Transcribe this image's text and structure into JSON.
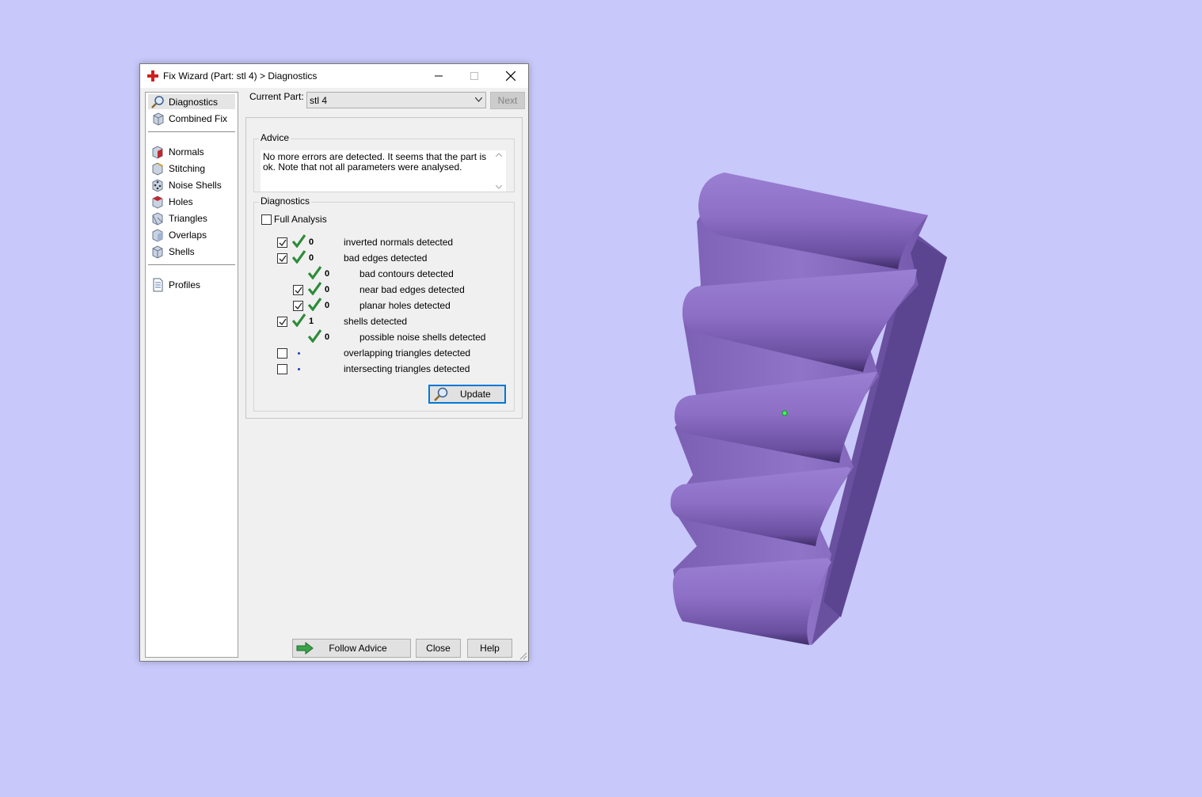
{
  "window": {
    "title": "Fix Wizard (Part: stl 4) > Diagnostics",
    "icon": "red-cross-icon"
  },
  "sidebar": {
    "items": [
      {
        "label": "Diagnostics",
        "icon": "magnifier-icon",
        "selected": true
      },
      {
        "label": "Combined Fix",
        "icon": "cube-stack-icon"
      },
      {
        "label": "Normals",
        "icon": "cube-red-face-icon"
      },
      {
        "label": "Stitching",
        "icon": "cube-stitch-icon"
      },
      {
        "label": "Noise Shells",
        "icon": "cube-dots-icon"
      },
      {
        "label": "Holes",
        "icon": "cube-hole-icon"
      },
      {
        "label": "Triangles",
        "icon": "cube-triangles-icon"
      },
      {
        "label": "Overlaps",
        "icon": "cube-overlap-icon"
      },
      {
        "label": "Shells",
        "icon": "cube-shell-icon"
      },
      {
        "label": "Profiles",
        "icon": "document-icon"
      }
    ]
  },
  "current_part": {
    "label": "Current Part:",
    "value": "stl 4",
    "next_label": "Next"
  },
  "advice": {
    "title": "Advice",
    "text": "No more errors are detected. It seems that the part is ok. Note that not all parameters were analysed."
  },
  "diagnostics": {
    "title": "Diagnostics",
    "full_analysis_label": "Full Analysis",
    "full_analysis_checked": false,
    "rows": [
      {
        "count": "0",
        "label": "inverted normals detected",
        "checked": true,
        "status": "ok"
      },
      {
        "count": "0",
        "label": "bad edges detected",
        "checked": true,
        "status": "ok"
      },
      {
        "count": "0",
        "label": "bad contours detected",
        "status": "ok"
      },
      {
        "count": "0",
        "label": "near bad edges detected",
        "checked": true,
        "status": "ok"
      },
      {
        "count": "0",
        "label": "planar holes detected",
        "checked": true,
        "status": "ok"
      },
      {
        "count": "1",
        "label": "shells detected",
        "checked": true,
        "status": "ok"
      },
      {
        "count": "0",
        "label": "possible noise shells detected",
        "status": "ok"
      },
      {
        "count": "",
        "label": "overlapping triangles detected",
        "checked": false,
        "status": "not-analysed"
      },
      {
        "count": "",
        "label": "intersecting triangles detected",
        "checked": false,
        "status": "not-analysed"
      }
    ],
    "update_label": "Update"
  },
  "buttons": {
    "follow_advice": "Follow Advice",
    "close": "Close",
    "help": "Help"
  },
  "colors": {
    "viewport_bg": "#c8c8fa",
    "model": "#8a6cbf",
    "check_green": "#2e8b3a",
    "focus_blue": "#0078d7"
  }
}
